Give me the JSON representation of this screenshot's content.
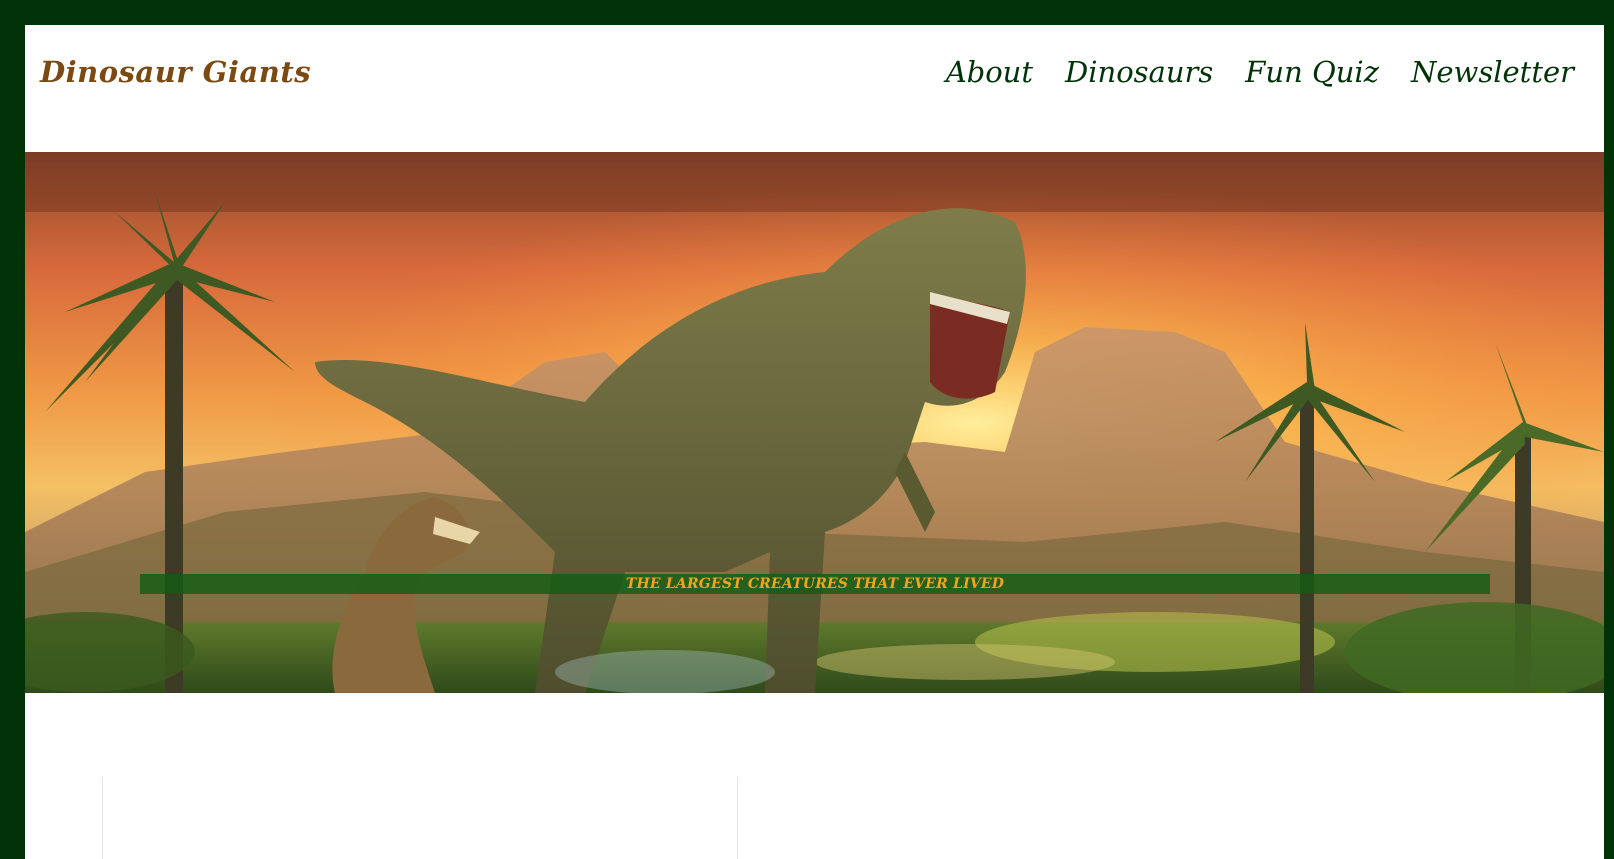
{
  "site": {
    "brand": "Dinosaur Giants"
  },
  "nav": {
    "items": [
      "About",
      "Dinosaurs",
      "Fun Quiz",
      "Newsletter"
    ]
  },
  "hero": {
    "image_alt": "T-rex roaring in a prehistoric landscape at sunset",
    "caption": "THE LARGEST CREATURES THAT EVER LIVED"
  },
  "colors": {
    "frame": "#013208",
    "brand_text": "#7a4a12",
    "nav_text": "#013208",
    "caption_bar": "#125c14",
    "caption_text": "#f3a41e"
  }
}
